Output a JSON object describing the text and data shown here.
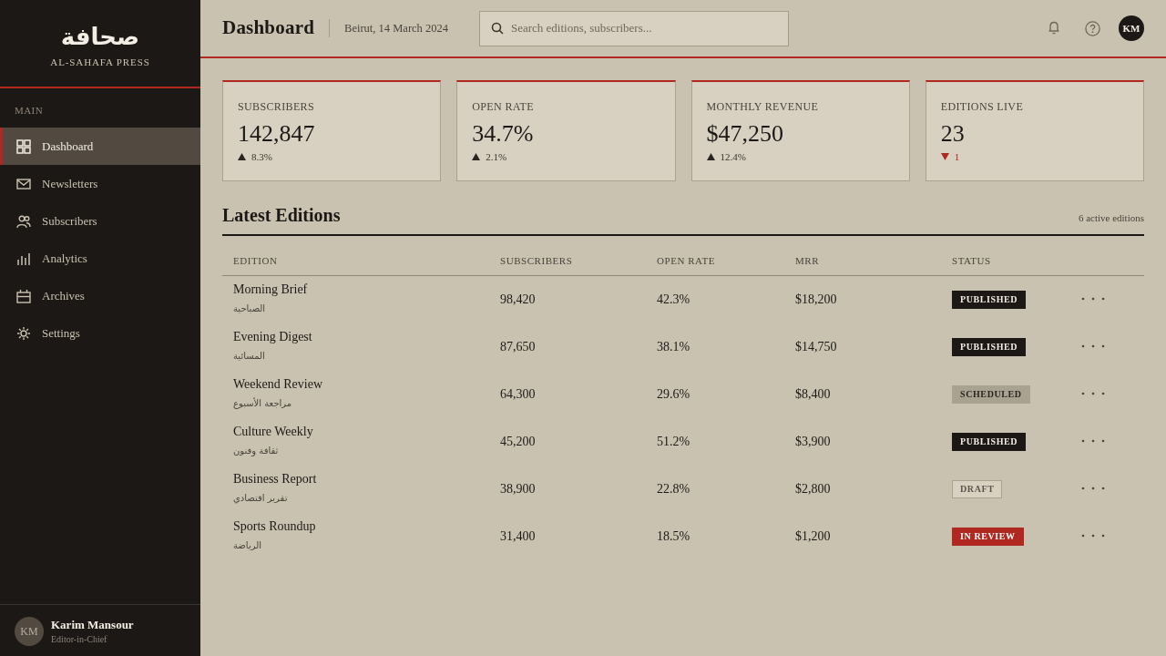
{
  "sidebar": {
    "logo": {
      "mark": "صحافة",
      "name": "AL-SAHAFA PRESS"
    },
    "section_label": "MAIN",
    "items": [
      {
        "label": "Dashboard",
        "selected": true
      },
      {
        "label": "Newsletters",
        "selected": false
      },
      {
        "label": "Subscribers",
        "selected": false
      },
      {
        "label": "Analytics",
        "selected": false
      },
      {
        "label": "Archives",
        "selected": false
      },
      {
        "label": "Settings",
        "selected": false
      }
    ],
    "user": {
      "initials": "KM",
      "name": "Karim Mansour",
      "role": "Editor-in-Chief"
    }
  },
  "header": {
    "title": "Dashboard",
    "date": "Beirut, 14 March 2024",
    "search": {
      "placeholder": "Search editions, subscribers..."
    },
    "avatar": "KM"
  },
  "stats": [
    {
      "label": "SUBSCRIBERS",
      "value": "142,847",
      "delta": "8.3%",
      "falling": false
    },
    {
      "label": "OPEN RATE",
      "value": "34.7%",
      "delta": "2.1%",
      "falling": false
    },
    {
      "label": "MONTHLY REVENUE",
      "value": "$47,250",
      "delta": "12.4%",
      "falling": false
    },
    {
      "label": "EDITIONS LIVE",
      "value": "23",
      "delta": "1",
      "falling": true
    }
  ],
  "editions": {
    "title": "Latest Editions",
    "count": "6 active editions",
    "columns": [
      "EDITION",
      "SUBSCRIBERS",
      "OPEN RATE",
      "MRR",
      "STATUS"
    ],
    "rows": [
      {
        "name": "Morning Brief",
        "arabic_name": "الصباحية",
        "subscribers": "98,420",
        "open_rate": "42.3%",
        "mrr": "$18,200",
        "status": {
          "label": "PUBLISHED",
          "kind": "published"
        }
      },
      {
        "name": "Evening Digest",
        "arabic_name": "المسائية",
        "subscribers": "87,650",
        "open_rate": "38.1%",
        "mrr": "$14,750",
        "status": {
          "label": "PUBLISHED",
          "kind": "published"
        }
      },
      {
        "name": "Weekend Review",
        "arabic_name": "مراجعة الأسبوع",
        "subscribers": "64,300",
        "open_rate": "29.6%",
        "mrr": "$8,400",
        "status": {
          "label": "SCHEDULED",
          "kind": "scheduled"
        }
      },
      {
        "name": "Culture Weekly",
        "arabic_name": "ثقافة وفنون",
        "subscribers": "45,200",
        "open_rate": "51.2%",
        "mrr": "$3,900",
        "status": {
          "label": "PUBLISHED",
          "kind": "published"
        }
      },
      {
        "name": "Business Report",
        "arabic_name": "تقرير اقتصادي",
        "subscribers": "38,900",
        "open_rate": "22.8%",
        "mrr": "$2,800",
        "status": {
          "label": "DRAFT",
          "kind": "draft"
        }
      },
      {
        "name": "Sports Roundup",
        "arabic_name": "الرياضة",
        "subscribers": "31,400",
        "open_rate": "18.5%",
        "mrr": "$1,200",
        "status": {
          "label": "IN REVIEW",
          "kind": "in_review"
        }
      }
    ]
  }
}
